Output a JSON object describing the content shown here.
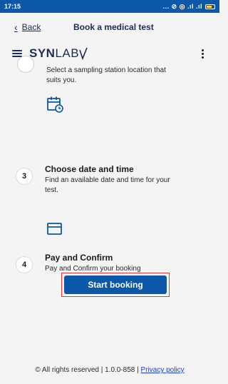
{
  "status_bar": {
    "time": "17:15",
    "icons_text": "... ⊘ ◎ .ıl .ıl"
  },
  "header": {
    "back_label": "Back",
    "title": "Book a medical test"
  },
  "brand": {
    "logo_bold": "SYN",
    "logo_light": "LAB"
  },
  "steps": [
    {
      "number": "",
      "title": "",
      "description": "Select a sampling station location that suits you."
    },
    {
      "number": "3",
      "title": "Choose date and time",
      "description": "Find an available date and time for your test.",
      "icon": "calendar-icon"
    },
    {
      "number": "4",
      "title": "Pay and Confirm",
      "description": "Pay and Confirm your booking",
      "icon": "card-icon"
    }
  ],
  "cta": {
    "label": "Start booking"
  },
  "footer": {
    "text": "© All rights reserved | 1.0.0-858 | ",
    "privacy_label": "Privacy policy"
  },
  "colors": {
    "primary": "#0b57a8",
    "text_dark": "#1b2b54",
    "highlight": "#e53935",
    "link": "#1a3fd6"
  }
}
